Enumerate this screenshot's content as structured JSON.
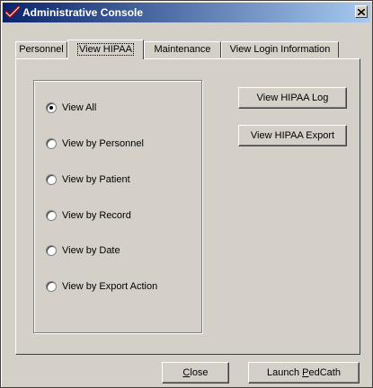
{
  "window": {
    "title": "Administrative Console",
    "close_label": "X"
  },
  "tabs": [
    {
      "label": "Personnel",
      "active": false
    },
    {
      "label": "View HIPAA",
      "active": true
    },
    {
      "label": "Maintenance",
      "active": false
    },
    {
      "label": "View Login Information",
      "active": false
    }
  ],
  "view_options": {
    "selected": "View All",
    "items": [
      {
        "label": "View All",
        "checked": true
      },
      {
        "label": "View by Personnel",
        "checked": false
      },
      {
        "label": "View by Patient",
        "checked": false
      },
      {
        "label": "View by Record",
        "checked": false
      },
      {
        "label": "View by Date",
        "checked": false
      },
      {
        "label": "View by Export Action",
        "checked": false
      }
    ]
  },
  "actions": {
    "hipaa_log": "View HIPAA Log",
    "hipaa_export": "View HIPAA Export"
  },
  "footer": {
    "close_mnemonic": "C",
    "close_rest": "lose",
    "launch_prefix": "Launch ",
    "launch_mnemonic": "P",
    "launch_rest": "edCath"
  },
  "colors": {
    "title_bar_start": "#0a246a",
    "title_bar_end": "#a6caf0",
    "face": "#d4d0c8"
  }
}
